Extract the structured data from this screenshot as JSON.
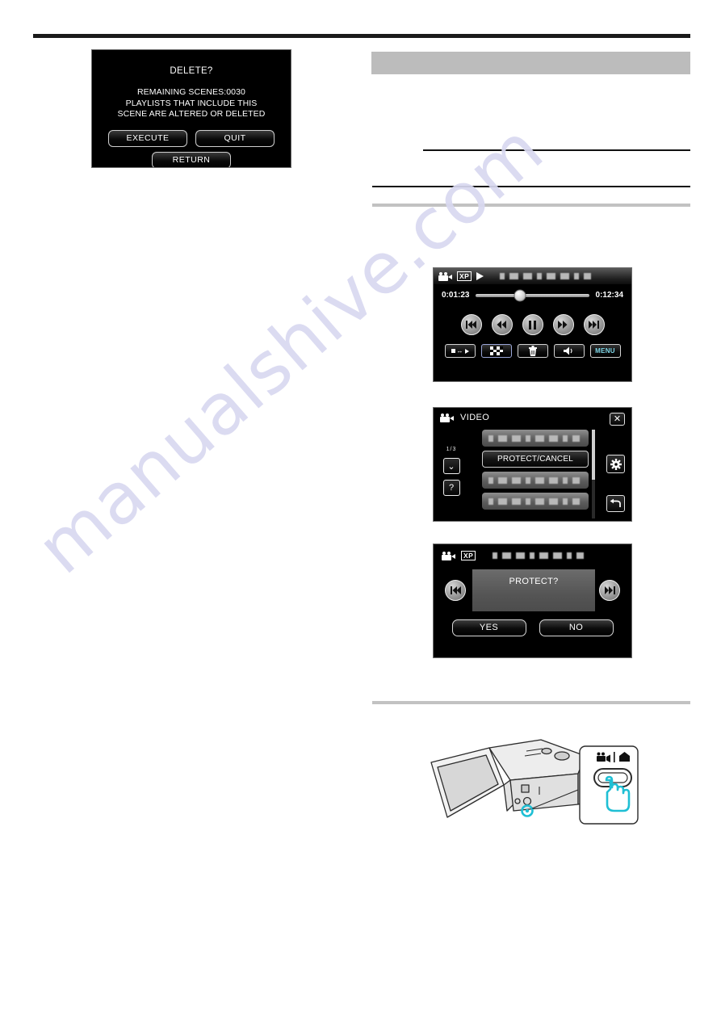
{
  "page": {
    "watermark": "manualshive.com"
  },
  "delete_dialog": {
    "name": "DELETE confirmation screen",
    "title": "DELETE?",
    "body_line1": "REMAINING SCENES:0030",
    "body_line2": "PLAYLISTS THAT INCLUDE THIS",
    "body_line3": "SCENE ARE ALTERED OR DELETED",
    "buttons": {
      "execute": "EXECUTE",
      "quit": "QUIT",
      "return": "RETURN"
    }
  },
  "playback_screen": {
    "name": "video playback screen",
    "quality_badge": "XP",
    "elapsed_time": "0:01:23",
    "total_time": "0:12:34",
    "progress_percent": 39,
    "transport": {
      "skip_back": "skip-backward",
      "rewind": "rewind",
      "pause": "pause",
      "forward": "fast-forward",
      "skip_forward": "skip-forward"
    },
    "toolbar": {
      "playback_switch": "playback-switch",
      "index": "index-screen",
      "delete": "delete",
      "volume": "volume",
      "menu": "MENU"
    }
  },
  "video_menu_screen": {
    "name": "VIDEO menu screen",
    "title": "VIDEO",
    "page_indicator": "1/3",
    "items": [
      {
        "label": "",
        "masked": true,
        "selected": false
      },
      {
        "label": "PROTECT/CANCEL",
        "masked": false,
        "selected": true
      },
      {
        "label": "",
        "masked": true,
        "selected": false
      },
      {
        "label": "",
        "masked": true,
        "selected": false
      }
    ],
    "controls": {
      "close": "close",
      "settings": "settings-gear",
      "back": "back-arrow",
      "scroll_down": "scroll-down",
      "help": "?"
    }
  },
  "protect_screen": {
    "name": "PROTECT confirmation screen",
    "quality_badge": "XP",
    "prompt": "PROTECT?",
    "buttons": {
      "yes": "YES",
      "no": "NO"
    },
    "nav": {
      "previous": "previous-scene",
      "next": "next-scene"
    }
  },
  "camcorder_figure": {
    "name": "camcorder mode switch illustration",
    "callout": "video-photo-mode-switch",
    "accent_color": "#1fbfd4"
  }
}
